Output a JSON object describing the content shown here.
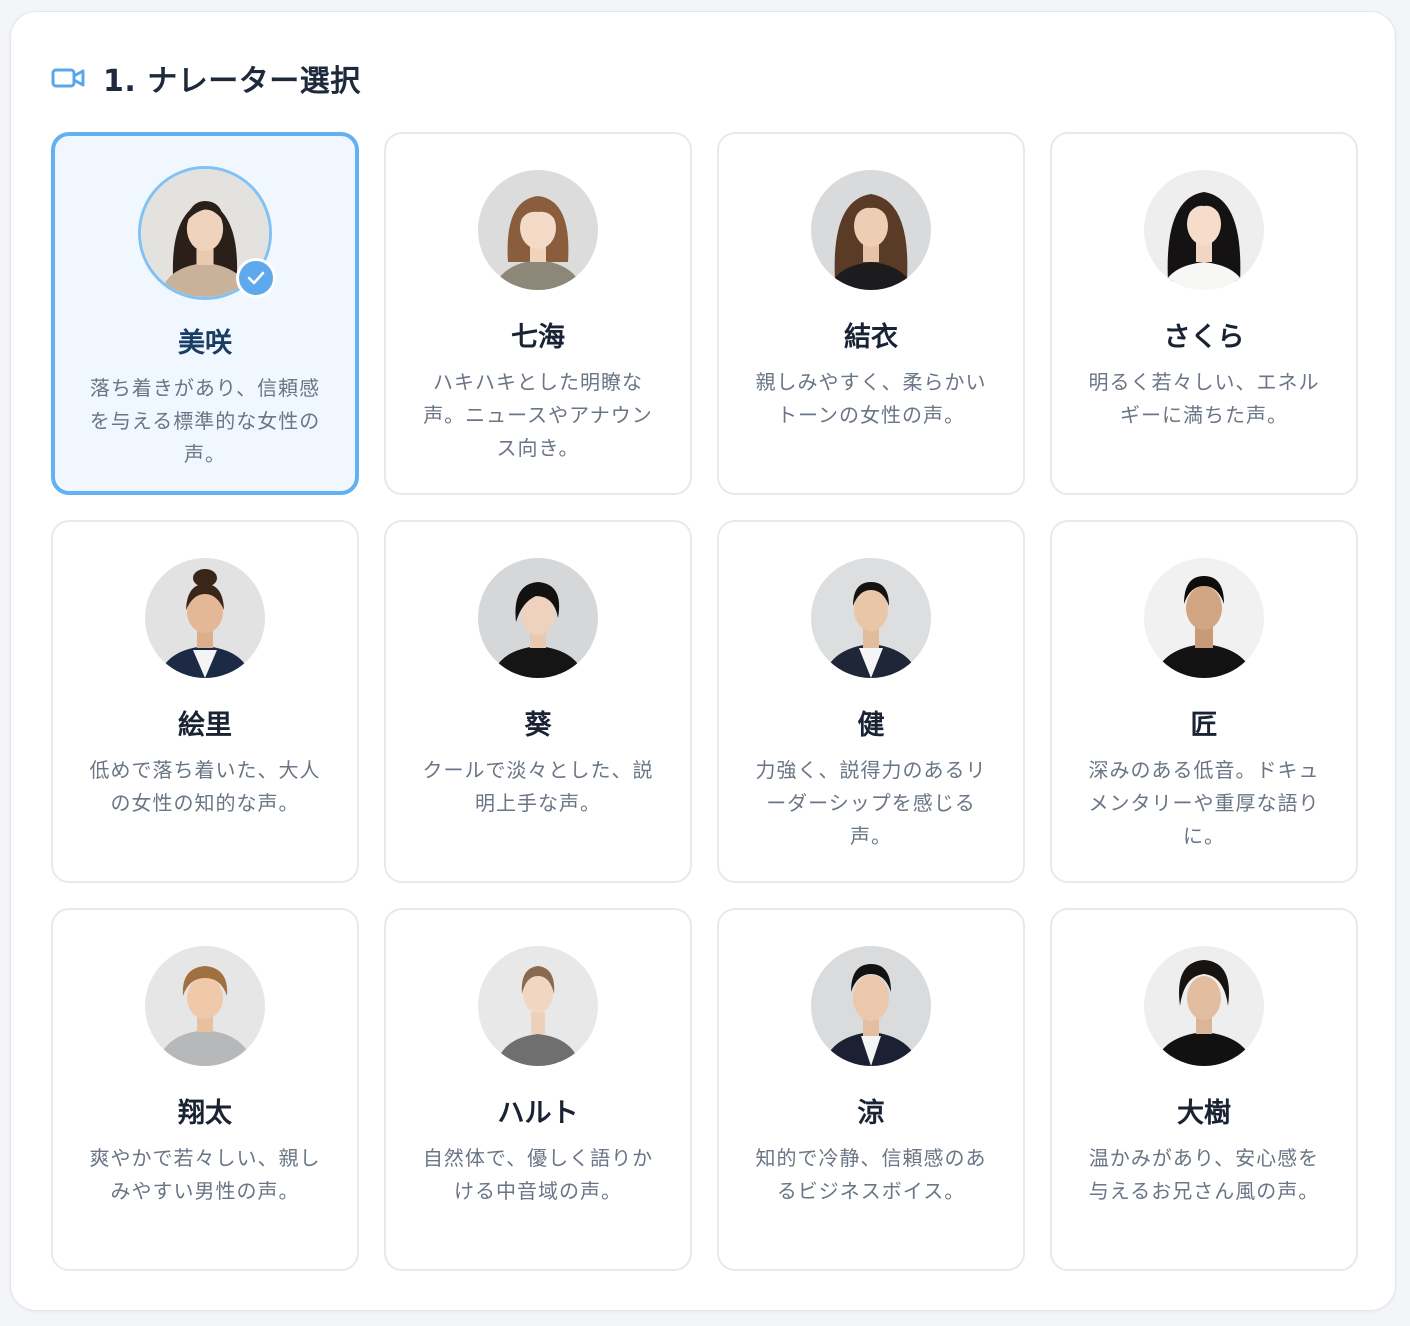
{
  "section": {
    "number": "1.",
    "title": "1. ナレーター選択",
    "icon": "video-camera-icon"
  },
  "colors": {
    "accent": "#64b1f2",
    "selected_bg": "#f1f7fe",
    "title": "#1e2a3b",
    "description": "#6a7585"
  },
  "narrators": [
    {
      "name": "美咲",
      "description": "落ち着きがあり、信頼感を与える標準的な女性の声。",
      "selected": true
    },
    {
      "name": "七海",
      "description": "ハキハキとした明瞭な声。ニュースやアナウンス向き。",
      "selected": false
    },
    {
      "name": "結衣",
      "description": "親しみやすく、柔らかいトーンの女性の声。",
      "selected": false
    },
    {
      "name": "さくら",
      "description": "明るく若々しい、エネルギーに満ちた声。",
      "selected": false
    },
    {
      "name": "絵里",
      "description": "低めで落ち着いた、大人の女性の知的な声。",
      "selected": false
    },
    {
      "name": "葵",
      "description": "クールで淡々とした、説明上手な声。",
      "selected": false
    },
    {
      "name": "健",
      "description": "力強く、説得力のあるリーダーシップを感じる声。",
      "selected": false
    },
    {
      "name": "匠",
      "description": "深みのある低音。ドキュメンタリーや重厚な語りに。",
      "selected": false
    },
    {
      "name": "翔太",
      "description": "爽やかで若々しい、親しみやすい男性の声。",
      "selected": false
    },
    {
      "name": "ハルト",
      "description": "自然体で、優しく語りかける中音域の声。",
      "selected": false
    },
    {
      "name": "涼",
      "description": "知的で冷静、信頼感のあるビジネスボイス。",
      "selected": false
    },
    {
      "name": "大樹",
      "description": "温かみがあり、安心感を与えるお兄さん風の声。",
      "selected": false
    }
  ]
}
